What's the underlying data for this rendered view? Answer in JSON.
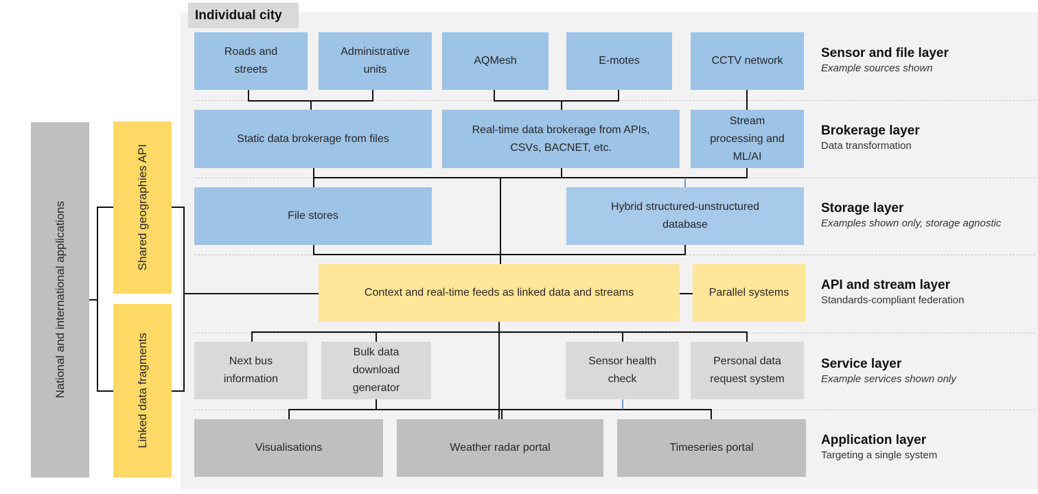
{
  "city": {
    "label": "Individual city"
  },
  "external": {
    "national_apps": "National and international applications",
    "shared_geographies": "Shared geographies API",
    "linked_fragments": "Linked data fragments"
  },
  "layers": [
    {
      "title": "Sensor and file layer",
      "subtitle": "Example sources shown",
      "subtitle_italic": true
    },
    {
      "title": "Brokerage layer",
      "subtitle": "Data transformation",
      "subtitle_italic": false
    },
    {
      "title": "Storage layer",
      "subtitle": "Examples shown only, storage agnostic",
      "subtitle_italic": true
    },
    {
      "title": "API and stream layer",
      "subtitle": "Standards-compliant federation",
      "subtitle_italic": false
    },
    {
      "title": "Service layer",
      "subtitle": "Example services shown only",
      "subtitle_italic": true
    },
    {
      "title": "Application layer",
      "subtitle": "Targeting a single system",
      "subtitle_italic": false
    }
  ],
  "sources": [
    "Roads and\nstreets",
    "Administrative\nunits",
    "AQMesh",
    "E-motes",
    "CCTV network"
  ],
  "brokerage": [
    "Static data brokerage from files",
    "Real-time data brokerage from APIs,\nCSVs, BACNET, etc.",
    "Stream\nprocessing and\nML/AI"
  ],
  "storage": [
    "File stores",
    "Hybrid structured-unstructured\ndatabase"
  ],
  "api": {
    "main": "Context and real-time feeds as linked data and streams",
    "parallel": "Parallel systems"
  },
  "services": [
    "Next bus\ninformation",
    "Bulk data\ndownload\ngenerator",
    "Sensor health\ncheck",
    "Personal data\nrequest system"
  ],
  "applications": [
    "Visualisations",
    "Weather radar portal",
    "Timeseries portal"
  ],
  "colors": {
    "source_blue": "#9dc3e6",
    "api_yellow": "#ffe699",
    "external_yellow": "#ffd966",
    "service_gray": "#d9d9d9",
    "application_gray": "#bfbfbf",
    "panel_gray": "#f2f2f2"
  }
}
